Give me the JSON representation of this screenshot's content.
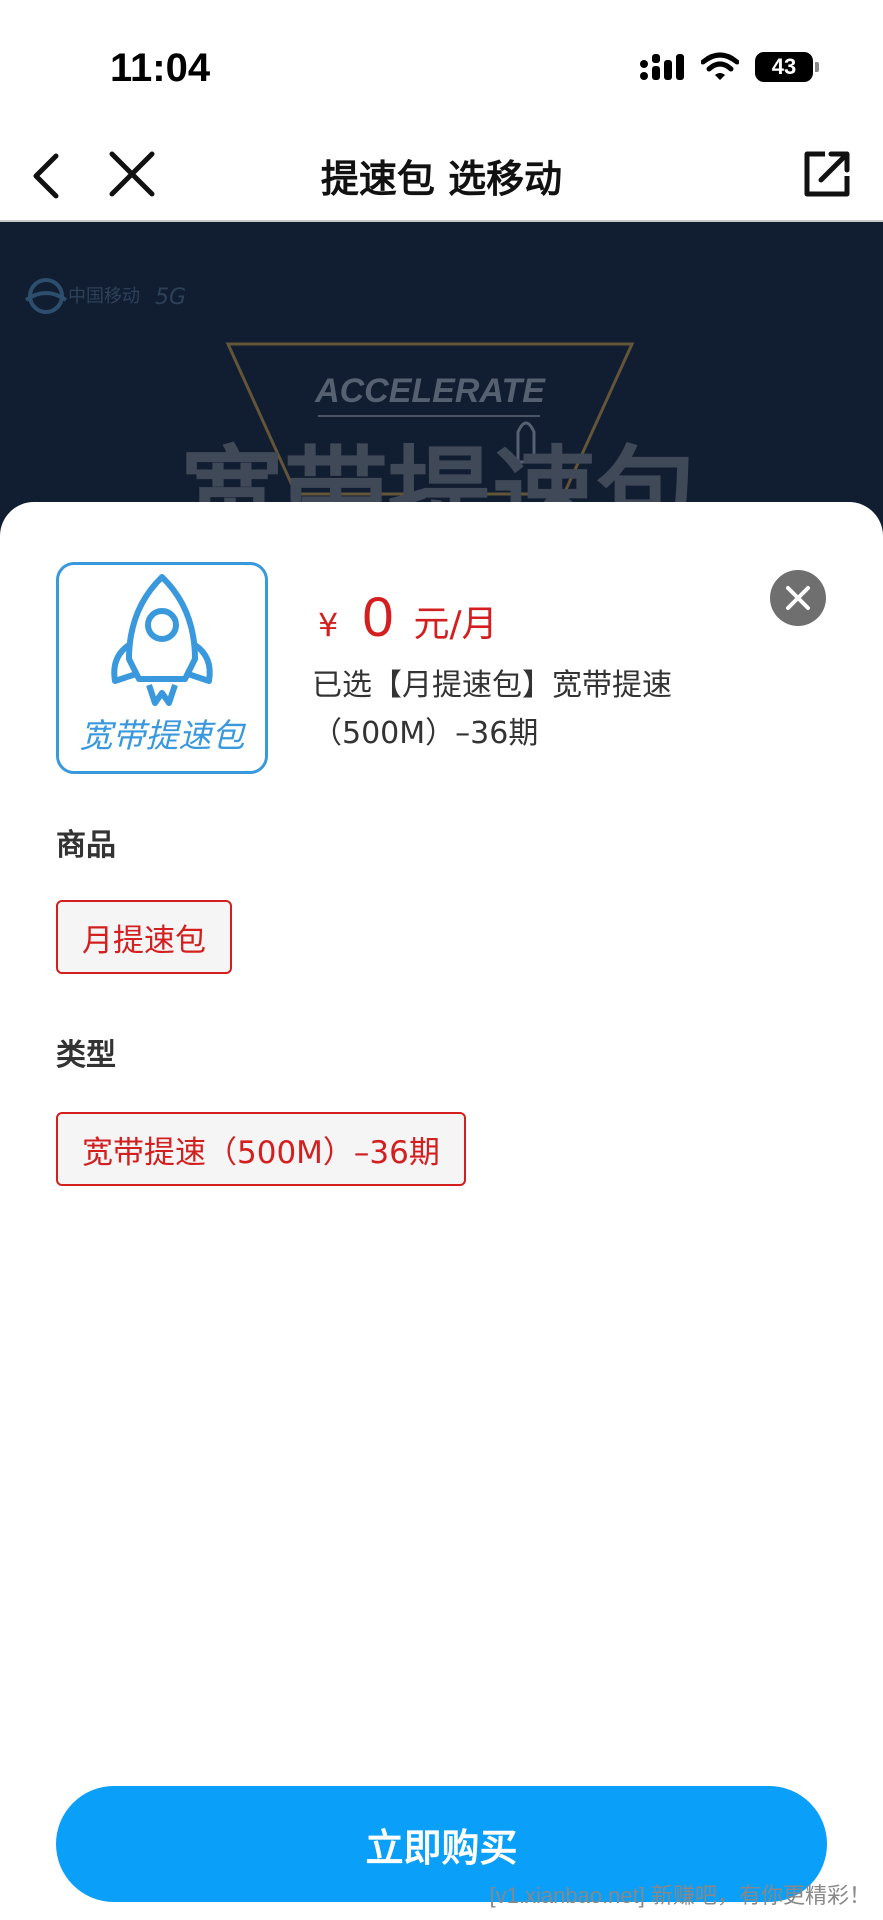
{
  "status_bar": {
    "time": "11:04",
    "battery_level": "43",
    "icons": [
      "signal-icon",
      "wifi-icon",
      "battery-icon"
    ]
  },
  "nav": {
    "title": "提速包 选移动",
    "icons": [
      "back-icon",
      "close-icon",
      "share-icon"
    ]
  },
  "banner": {
    "brand_text": "中国移动",
    "tagline": "ACCELERATE",
    "headline": "宽带提速包"
  },
  "product": {
    "thumbnail_label": "宽带提速包",
    "price_symbol": "¥",
    "price_value": "0",
    "price_unit": "元/月",
    "selected_line1": "已选【月提速包】宽带提速",
    "selected_line2": "（500M）–36期"
  },
  "sections": {
    "goods_label": "商品",
    "goods_option": "月提速包",
    "type_label": "类型",
    "type_option": "宽带提速（500M）–36期"
  },
  "actions": {
    "buy_label": "立即购买"
  },
  "watermark": "[v1.xianbao.net] 新赚吧，有你更精彩！",
  "colors": {
    "accent_red": "#d31f1f",
    "primary_blue": "#0a9ff8",
    "thumb_blue": "#3a99dc"
  }
}
